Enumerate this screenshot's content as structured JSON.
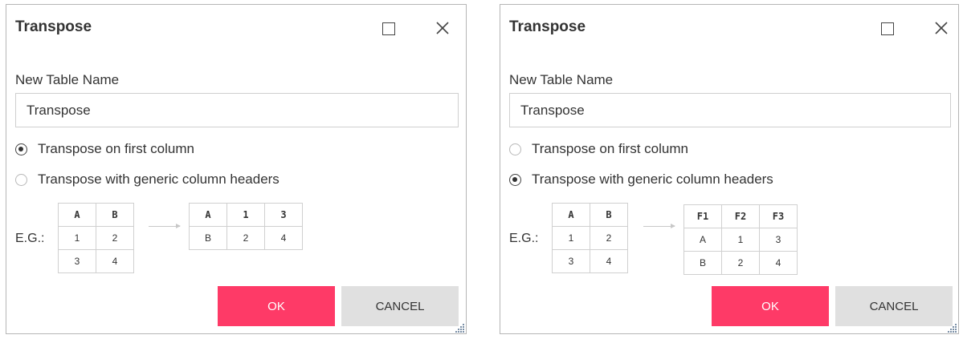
{
  "dialogs": [
    {
      "title": "Transpose",
      "new_table_label": "New Table Name",
      "table_name_value": "Transpose",
      "radio_first_column": "Transpose on first column",
      "radio_generic_headers": "Transpose with generic column headers",
      "selected_option": "first_column",
      "eg_label": "E.G.:",
      "source_table": [
        [
          "A",
          "B"
        ],
        [
          "1",
          "2"
        ],
        [
          "3",
          "4"
        ]
      ],
      "result_table": [
        [
          "A",
          "1",
          "3"
        ],
        [
          "B",
          "2",
          "4"
        ]
      ],
      "ok_label": "OK",
      "cancel_label": "CANCEL"
    },
    {
      "title": "Transpose",
      "new_table_label": "New Table Name",
      "table_name_value": "Transpose",
      "radio_first_column": "Transpose on first column",
      "radio_generic_headers": "Transpose with generic column headers",
      "selected_option": "generic_headers",
      "eg_label": "E.G.:",
      "source_table": [
        [
          "A",
          "B"
        ],
        [
          "1",
          "2"
        ],
        [
          "3",
          "4"
        ]
      ],
      "result_table": [
        [
          "F1",
          "F2",
          "F3"
        ],
        [
          "A",
          "1",
          "3"
        ],
        [
          "B",
          "2",
          "4"
        ]
      ],
      "ok_label": "OK",
      "cancel_label": "CANCEL"
    }
  ],
  "colors": {
    "ok_button": "#fe3a67",
    "cancel_button": "#e0e0e0"
  },
  "icons": {
    "maximize": "maximize-icon",
    "close": "close-icon",
    "resize": "resize-grip-icon",
    "arrow": "arrow-right-icon"
  }
}
